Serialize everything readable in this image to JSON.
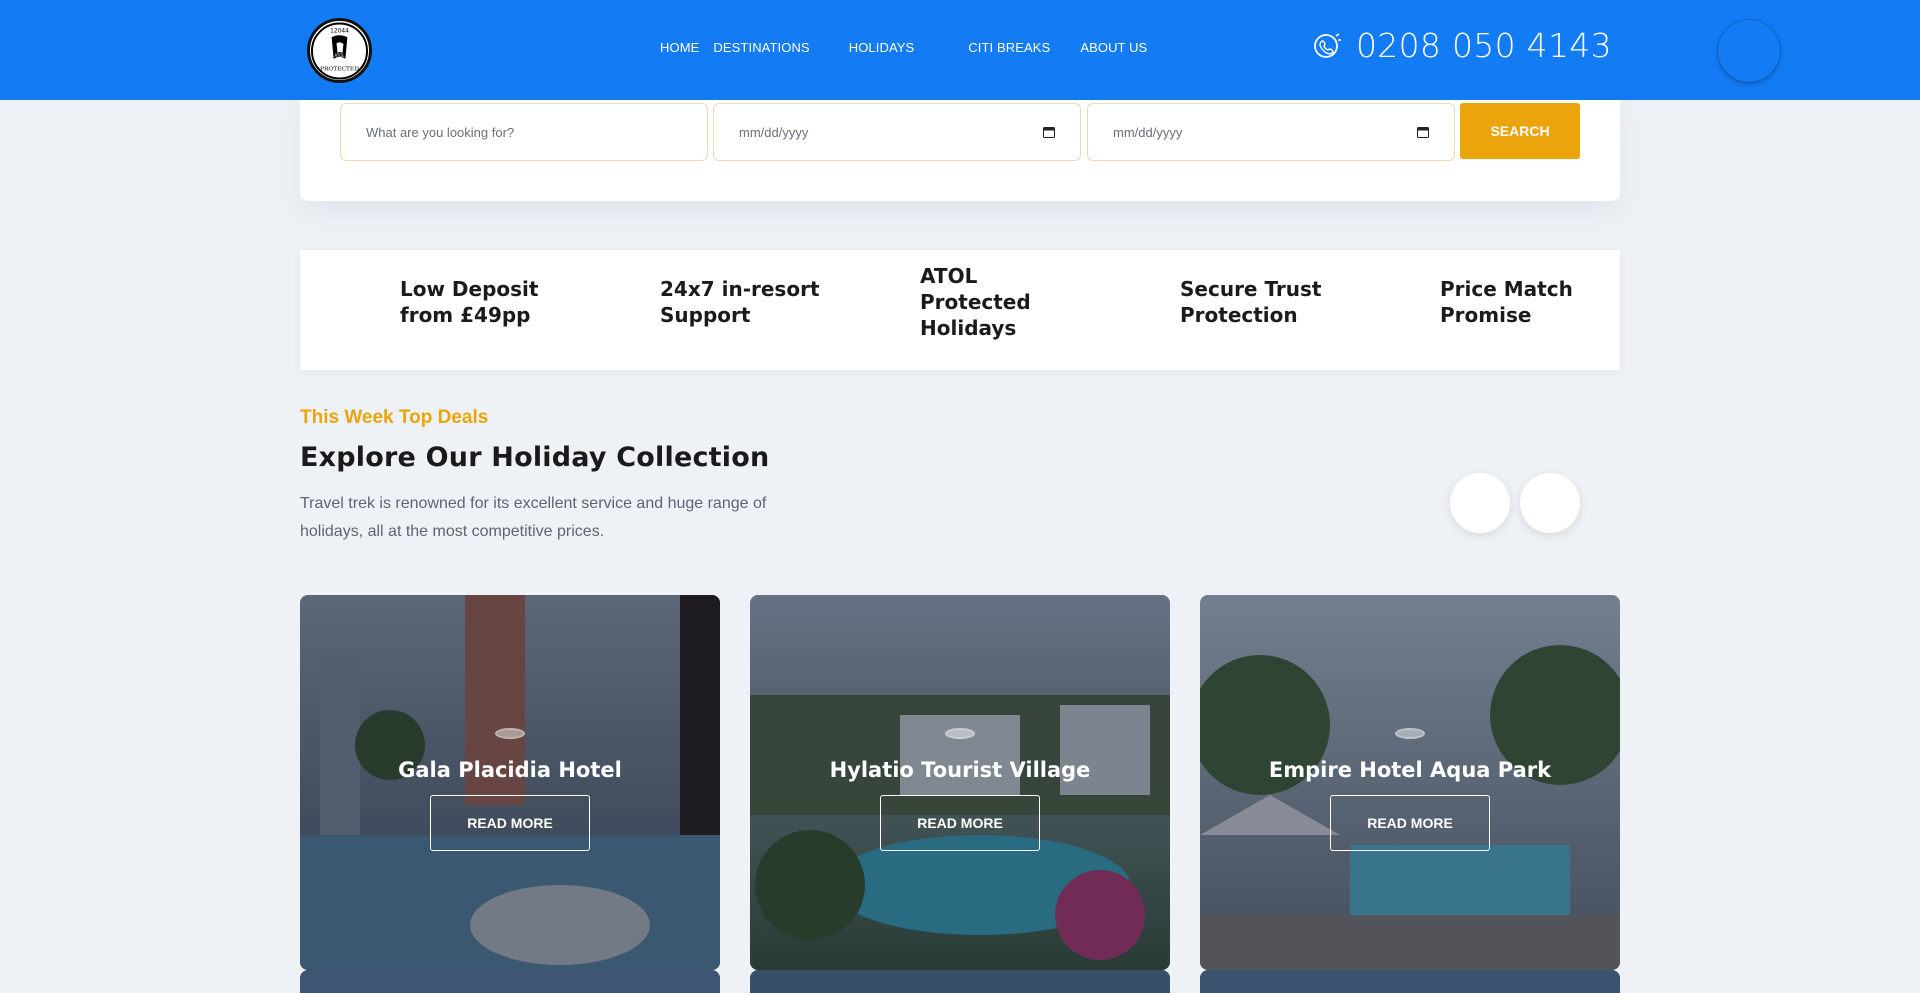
{
  "header": {
    "logo": {
      "text": "12044 ATOL PROTECTED"
    },
    "nav": [
      {
        "label": "HOME",
        "has_dropdown": false
      },
      {
        "label": "DESTINATIONS",
        "has_dropdown": true
      },
      {
        "label": "HOLIDAYS",
        "has_dropdown": true
      },
      {
        "label": "CITI BREAKS",
        "has_dropdown": false
      },
      {
        "label": "ABOUT US",
        "has_dropdown": false
      }
    ],
    "phone": {
      "icon": "phone-support-icon",
      "number": "0208 050 4143"
    },
    "background_color": "#137cf5"
  },
  "search": {
    "query": {
      "value": "",
      "placeholder": "What are you looking for?"
    },
    "check_in": {
      "display": "mm/dd/yyyy"
    },
    "check_out": {
      "display": "mm/dd/yyyy"
    },
    "button_label": "SEARCH",
    "button_color": "#eba40b"
  },
  "features": [
    {
      "line1": "Low Deposit",
      "line2": "from £49pp",
      "line3": ""
    },
    {
      "line1": "24x7 in-resort",
      "line2": "Support",
      "line3": ""
    },
    {
      "line1": "ATOL",
      "line2": "Protected",
      "line3": "Holidays"
    },
    {
      "line1": "Secure Trust",
      "line2": "Protection",
      "line3": ""
    },
    {
      "line1": "Price Match",
      "line2": "Promise",
      "line3": ""
    }
  ],
  "deals": {
    "eyebrow": "This Week Top Deals",
    "title": "Explore Our Holiday Collection",
    "description": "Travel trek is renowned for its excellent service and huge range of holidays, all at the most competitive prices.",
    "cards": [
      {
        "title": "Gala Placidia Hotel",
        "button_label": "READ MORE"
      },
      {
        "title": "Hylatio Tourist Village",
        "button_label": "READ MORE"
      },
      {
        "title": "Empire Hotel Aqua Park",
        "button_label": "READ MORE"
      }
    ]
  }
}
